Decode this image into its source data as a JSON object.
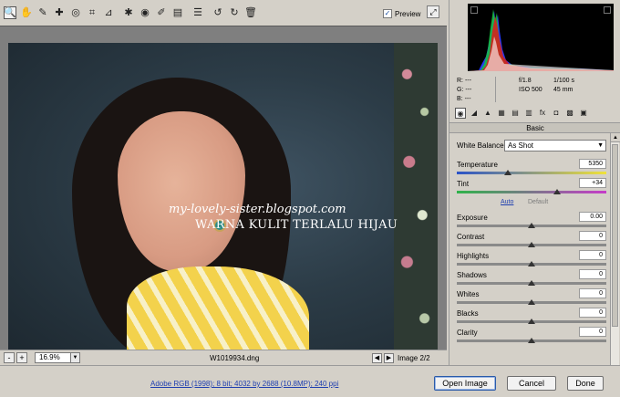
{
  "toolbar": {
    "tools": [
      {
        "name": "zoom-tool-icon",
        "glyph": "🔍"
      },
      {
        "name": "hand-tool-icon",
        "glyph": "✋"
      },
      {
        "name": "white-balance-tool-icon",
        "glyph": "✎"
      },
      {
        "name": "color-sampler-tool-icon",
        "glyph": "✚"
      },
      {
        "name": "targeted-adjustment-tool-icon",
        "glyph": "◎"
      },
      {
        "name": "crop-tool-icon",
        "glyph": "⌗"
      },
      {
        "name": "straighten-tool-icon",
        "glyph": "⊿"
      },
      {
        "name": "spot-removal-tool-icon",
        "glyph": "✱"
      },
      {
        "name": "red-eye-tool-icon",
        "glyph": "◉"
      },
      {
        "name": "adjustment-brush-icon",
        "glyph": "✐"
      },
      {
        "name": "graduated-filter-icon",
        "glyph": "▤"
      },
      {
        "name": "preferences-icon",
        "glyph": "☰"
      },
      {
        "name": "rotate-left-icon",
        "glyph": "↺"
      },
      {
        "name": "rotate-right-icon",
        "glyph": "↻"
      },
      {
        "name": "trash-icon",
        "glyph": "🗑"
      }
    ],
    "preview_label": "Preview",
    "preview_checked": "✓"
  },
  "image": {
    "watermark_url": "my-lovely-sister.blogspot.com",
    "watermark_caption": "WARNA KULIT TERLALU HIJAU"
  },
  "image_status": {
    "zoom_minus": "-",
    "zoom_plus": "+",
    "zoom_value": "16.9%",
    "filename": "W1019934.dng",
    "prev_arrow": "◀",
    "next_arrow": "▶",
    "image_count": "Image 2/2"
  },
  "readout": {
    "r_label": "R:",
    "r_value": "---",
    "g_label": "G:",
    "g_value": "---",
    "b_label": "B:",
    "b_value": "---",
    "aperture": "f/1.8",
    "shutter": "1/100 s",
    "iso": "ISO 500",
    "focal": "45 mm"
  },
  "panel_tabs": [
    "◉",
    "◢",
    "▲",
    "▦",
    "▤",
    "▥",
    "fx",
    "◘",
    "▩",
    "▣"
  ],
  "section_title": "Basic",
  "white_balance": {
    "label": "White Balance:",
    "value": "As Shot"
  },
  "sliders_wb": [
    {
      "name": "temperature",
      "label": "Temperature",
      "value": "5350",
      "position": 0.34,
      "track": "temp"
    },
    {
      "name": "tint",
      "label": "Tint",
      "value": "+34",
      "position": 0.67,
      "track": "tint"
    }
  ],
  "auto_default": {
    "auto": "Auto",
    "default": "Default"
  },
  "sliders_tone": [
    {
      "name": "exposure",
      "label": "Exposure",
      "value": "0.00",
      "position": 0.5
    },
    {
      "name": "contrast",
      "label": "Contrast",
      "value": "0",
      "position": 0.5
    },
    {
      "name": "highlights",
      "label": "Highlights",
      "value": "0",
      "position": 0.5
    },
    {
      "name": "shadows",
      "label": "Shadows",
      "value": "0",
      "position": 0.5
    },
    {
      "name": "whites",
      "label": "Whites",
      "value": "0",
      "position": 0.5
    },
    {
      "name": "blacks",
      "label": "Blacks",
      "value": "0",
      "position": 0.5
    },
    {
      "name": "clarity",
      "label": "Clarity",
      "value": "0",
      "position": 0.5
    }
  ],
  "footer": {
    "workflow": "Adobe RGB (1998); 8 bit; 4032 by 2688 (10.8MP); 240 ppi",
    "open_image": "Open Image",
    "cancel": "Cancel",
    "done": "Done"
  }
}
